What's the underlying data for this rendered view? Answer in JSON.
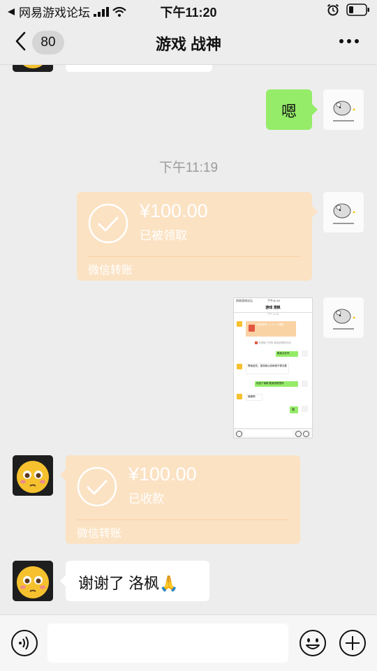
{
  "status_bar": {
    "carrier": "网易游戏论坛",
    "time": "下午11:20"
  },
  "nav": {
    "back_count": "80",
    "title": "游戏 战神"
  },
  "messages": {
    "reply_text": "嗯",
    "timestamp": "下午11:19",
    "sent_transfer": {
      "amount": "¥100.00",
      "status": "已被领取",
      "label": "微信转账"
    },
    "received_transfer": {
      "amount": "¥100.00",
      "status": "已收款",
      "label": "微信转账"
    },
    "thanks_text": "谢谢了  洛枫🙏"
  },
  "screenshot_thumb": {
    "carrier": "网易游戏论坛",
    "time": "下午11:19",
    "title": "游戏 澄枫",
    "timestamp": "下午 11:15",
    "redpacket_text": "抢来拿吧，一人一个满意",
    "notice": "你领取了你的 游戏战神的红包",
    "m1": "戴某去在吗",
    "m2": "帮我给些。虽然我以前和他不算无数",
    "m3": "你送个事群 戴某别群里吗",
    "m4": "随便啊",
    "m5": "嗯"
  },
  "colors": {
    "background": "#ededed",
    "green_bubble": "#95ec69",
    "transfer": "#fbe2c3"
  }
}
